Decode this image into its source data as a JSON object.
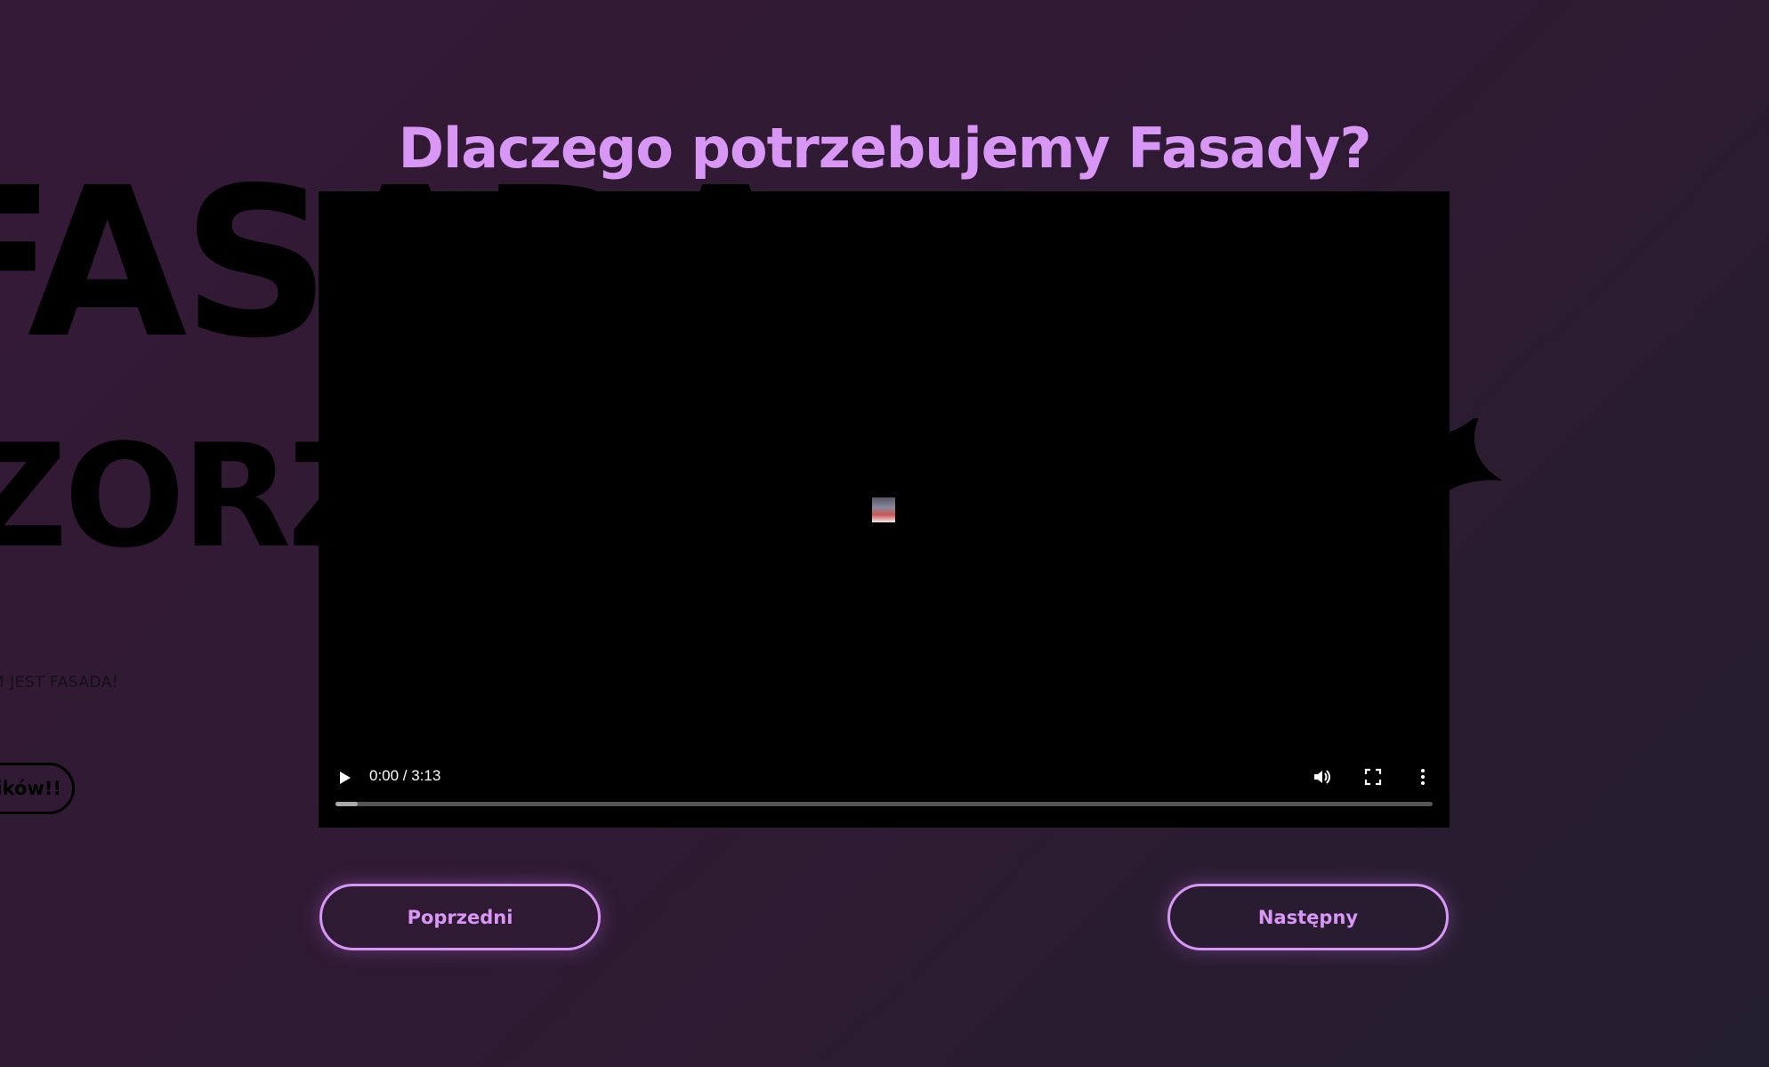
{
  "background": {
    "headline_line1": "FASADA",
    "headline_line2": "ZORZ",
    "tagline": "M JEST FASADA!",
    "cta_label": "mików!!"
  },
  "title": "Dlaczego potrzebujemy Fasady?",
  "video": {
    "time": "0:00 / 3:13",
    "progress_percent": 2,
    "icons": [
      "play-icon",
      "volume-icon",
      "fullscreen-icon",
      "more-options-icon"
    ]
  },
  "nav": {
    "prev_label": "Poprzedni",
    "next_label": "Następny"
  },
  "colors": {
    "accent": "#d896f5",
    "background": "#2f1a33"
  }
}
